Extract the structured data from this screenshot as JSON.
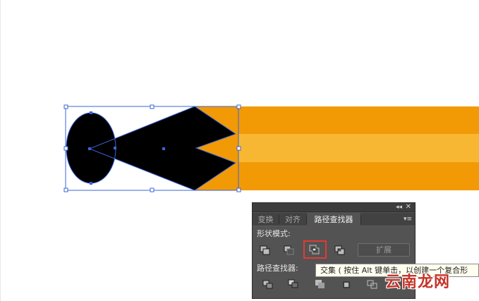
{
  "colors": {
    "orange_dark": "#f29a06",
    "orange_light": "#f8b733",
    "shape_fill": "#000000",
    "selection": "#3a64d8",
    "panel_bg": "#535353",
    "highlight": "#e33a35"
  },
  "panel": {
    "tabs": [
      {
        "label": "变换"
      },
      {
        "label": "对齐"
      },
      {
        "label": "路径查找器"
      }
    ],
    "active_tab_index": 2,
    "shape_modes_label": "形状模式:",
    "pathfinders_label": "路径查找器:",
    "expand_button": "扩展",
    "shape_mode_icons": [
      "unite-icon",
      "minus-front-icon",
      "intersect-icon",
      "exclude-icon"
    ],
    "pathfinder_icons": [
      "divide-icon",
      "trim-icon",
      "merge-icon",
      "crop-icon",
      "outline-icon"
    ]
  },
  "tooltip": {
    "text": "交集 ( 按住 Alt 键单击，以创建一个复合形"
  },
  "watermark": {
    "text": "云南龙网"
  }
}
